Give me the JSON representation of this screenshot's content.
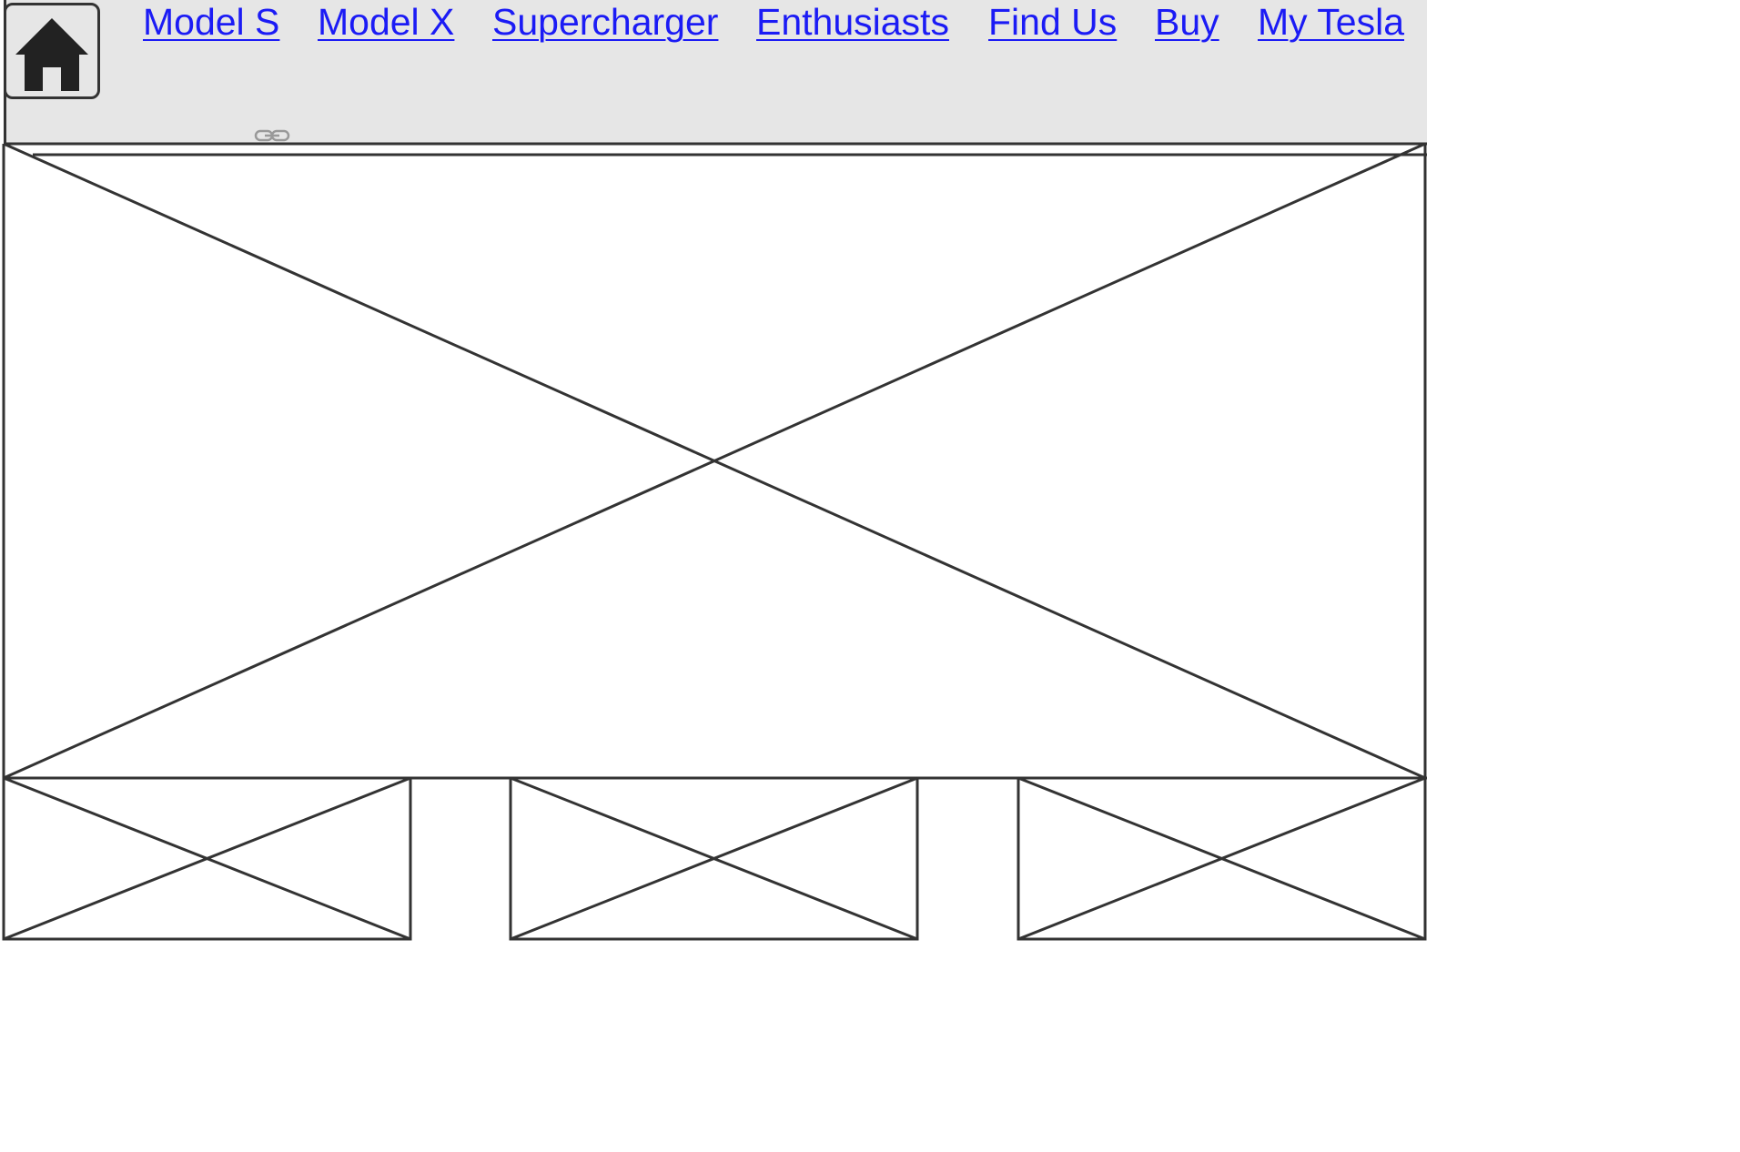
{
  "header": {
    "home_icon": "home-icon",
    "link_icon": "link-icon",
    "nav": [
      {
        "label": "Model S"
      },
      {
        "label": "Model X"
      },
      {
        "label": "Supercharger"
      },
      {
        "label": "Enthusiasts"
      },
      {
        "label": "Find Us"
      },
      {
        "label": "Buy"
      },
      {
        "label": "My Tesla"
      }
    ]
  },
  "colors": {
    "header_background": "#e6e6e6",
    "link": "#1b1bf5",
    "wireframe_stroke": "#333333"
  }
}
